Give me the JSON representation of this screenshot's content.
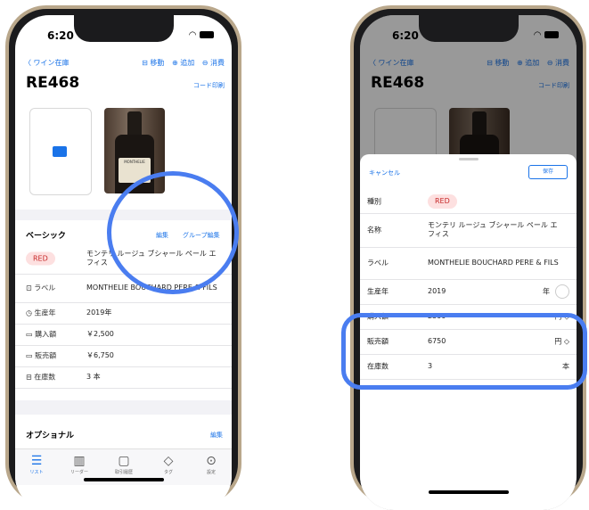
{
  "status": {
    "time": "6:20"
  },
  "nav": {
    "back": "〈 ワイン在庫",
    "move": "⊟ 移動",
    "add": "⊕ 追加",
    "consume": "⊖ 消費"
  },
  "detail": {
    "code": "RE468",
    "print": "コード印刷",
    "bottle_label": "MONTHELIE",
    "basic_title": "ベーシック",
    "edit": "編集",
    "group_edit": "グループ編集",
    "type_badge": "RED",
    "name": "モンテリ ルージュ ブシャール ペール エ フィス",
    "rows": [
      {
        "label": "ラベル",
        "value": "MONTHELIE BOUCHARD PERE & FILS"
      },
      {
        "label": "生産年",
        "value": "2019年"
      },
      {
        "label": "購入額",
        "value": "￥2,500"
      },
      {
        "label": "販売額",
        "value": "￥6,750"
      },
      {
        "label": "在庫数",
        "value": "3 本"
      }
    ],
    "optional_title": "オプショナル",
    "optional_edit": "編集"
  },
  "tabs": [
    {
      "label": "リスト",
      "icon": "list-icon"
    },
    {
      "label": "リーダー",
      "icon": "barcode-icon"
    },
    {
      "label": "取引履歴",
      "icon": "tray-icon"
    },
    {
      "label": "タグ",
      "icon": "tag-icon"
    },
    {
      "label": "設定",
      "icon": "more-icon"
    }
  ],
  "sheet": {
    "cancel": "キャンセル",
    "save": "保存",
    "fields": [
      {
        "label": "種別",
        "value": "RED",
        "unit": ""
      },
      {
        "label": "名称",
        "value": "モンテリ ルージュ ブシャール ペール エ フィス",
        "unit": ""
      },
      {
        "label": "ラベル",
        "value": "MONTHELIE BOUCHARD PERE & FILS",
        "unit": ""
      },
      {
        "label": "生産年",
        "value": "2019",
        "unit": "年"
      },
      {
        "label": "購入額",
        "value": "2500",
        "unit": "円 ◇"
      },
      {
        "label": "販売額",
        "value": "6750",
        "unit": "円 ◇"
      },
      {
        "label": "在庫数",
        "value": "3",
        "unit": "本"
      }
    ]
  },
  "colors": {
    "accent": "#1a73e8",
    "highlight": "#4a7df0",
    "red_badge": "#fde0e0"
  }
}
